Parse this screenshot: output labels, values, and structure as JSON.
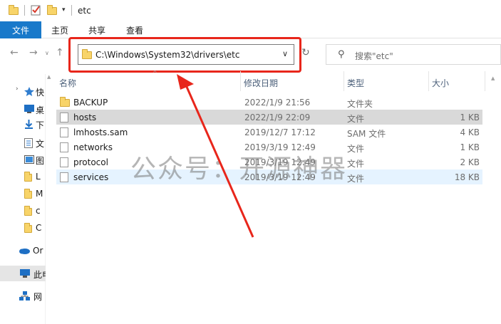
{
  "window": {
    "title": "etc"
  },
  "ribbon": {
    "tabs": [
      "文件",
      "主页",
      "共享",
      "查看"
    ]
  },
  "address": {
    "path": "C:\\Windows\\System32\\drivers\\etc"
  },
  "search": {
    "placeholder": "搜索\"etc\""
  },
  "nav": {
    "items": [
      {
        "label": "快",
        "icon": "star-icon"
      },
      {
        "label": "桌",
        "icon": "desktop-icon"
      },
      {
        "label": "下",
        "icon": "download-icon"
      },
      {
        "label": "文",
        "icon": "document-icon"
      },
      {
        "label": "图",
        "icon": "picture-icon"
      },
      {
        "label": "L",
        "icon": "folder-icon"
      },
      {
        "label": "M",
        "icon": "folder-icon"
      },
      {
        "label": "c",
        "icon": "folder-icon"
      },
      {
        "label": "C",
        "icon": "folder-icon"
      },
      {
        "label": "Or",
        "icon": "onedrive-icon"
      },
      {
        "label": "此电",
        "icon": "this-pc-icon"
      },
      {
        "label": "网",
        "icon": "network-icon"
      }
    ]
  },
  "columns": {
    "name": "名称",
    "modified": "修改日期",
    "type": "类型",
    "size": "大小"
  },
  "files": [
    {
      "name": "BACKUP",
      "modified": "2022/1/9 21:56",
      "type": "文件夹",
      "size": "",
      "kind": "folder"
    },
    {
      "name": "hosts",
      "modified": "2022/1/9 22:09",
      "type": "文件",
      "size": "1 KB",
      "kind": "file"
    },
    {
      "name": "lmhosts.sam",
      "modified": "2019/12/7 17:12",
      "type": "SAM 文件",
      "size": "4 KB",
      "kind": "file"
    },
    {
      "name": "networks",
      "modified": "2019/3/19 12:49",
      "type": "文件",
      "size": "1 KB",
      "kind": "file"
    },
    {
      "name": "protocol",
      "modified": "2019/3/19 12:49",
      "type": "文件",
      "size": "2 KB",
      "kind": "file"
    },
    {
      "name": "services",
      "modified": "2019/3/19 12:49",
      "type": "文件",
      "size": "18 KB",
      "kind": "file"
    }
  ],
  "watermark": "公众号：开源神器",
  "colors": {
    "accent": "#1979ca",
    "highlight": "#e8261b",
    "folder": "#f8d469"
  }
}
